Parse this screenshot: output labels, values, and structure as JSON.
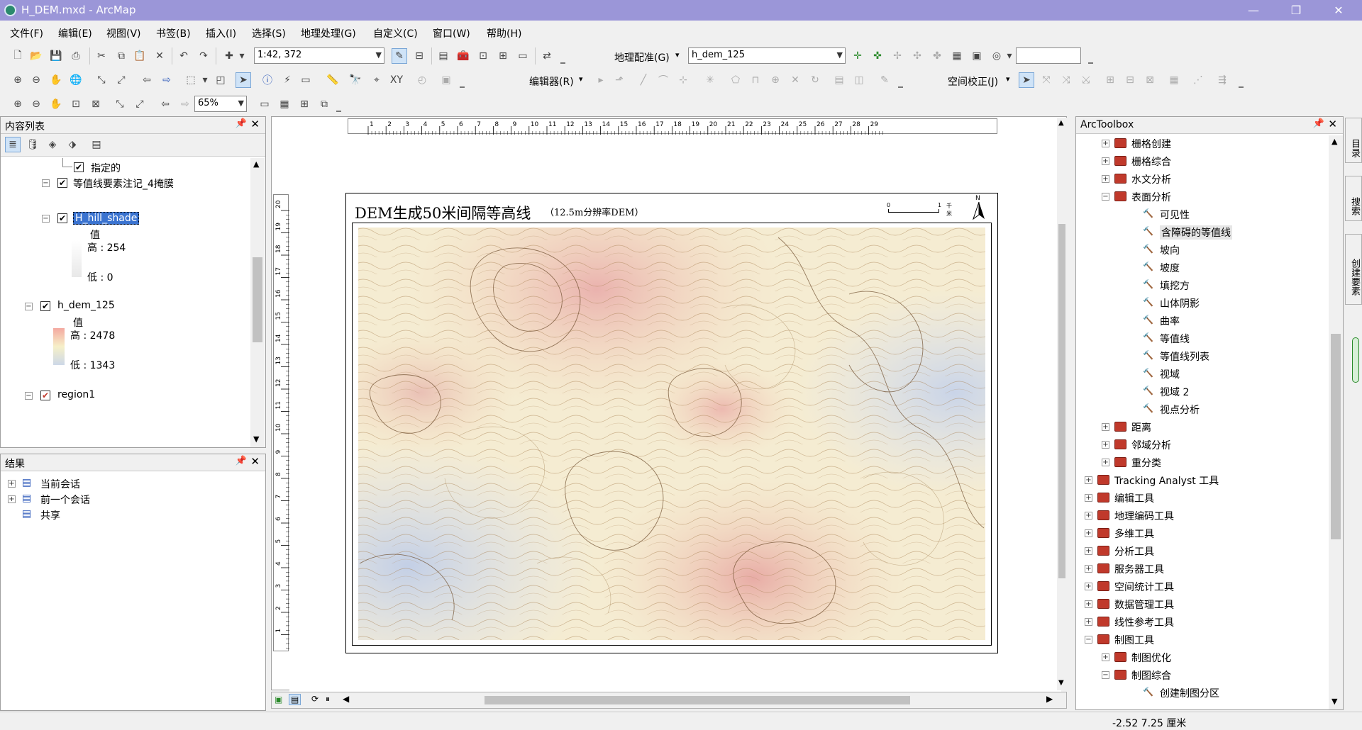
{
  "window": {
    "title": "H_DEM.mxd - ArcMap",
    "minimize": "—",
    "maximize": "❐",
    "close": "✕"
  },
  "menu": [
    "文件(F)",
    "编辑(E)",
    "视图(V)",
    "书签(B)",
    "插入(I)",
    "选择(S)",
    "地理处理(G)",
    "自定义(C)",
    "窗口(W)",
    "帮助(H)"
  ],
  "toolbar": {
    "scale_value": "1:42, 372",
    "georef_label": "地理配准(G)",
    "georef_layer": "h_dem_125",
    "editor_label": "编辑器(R)",
    "spatial_adjust_label": "空间校正(J)",
    "zoom_value": "65%"
  },
  "toc": {
    "title": "内容列表",
    "items": [
      {
        "label": "指定的"
      },
      {
        "label": "等值线要素注记_4掩膜"
      },
      {
        "label": "H_hill_shade"
      },
      {
        "label": "值"
      },
      {
        "label": "高 : 254"
      },
      {
        "label": "低 : 0"
      },
      {
        "label": "h_dem_125"
      },
      {
        "label": "值"
      },
      {
        "label": "高 : 2478"
      },
      {
        "label": "低 : 1343"
      },
      {
        "label": "region1"
      }
    ]
  },
  "results": {
    "title": "结果",
    "items": [
      {
        "label": "当前会话"
      },
      {
        "label": "前一个会话"
      },
      {
        "label": "共享"
      }
    ]
  },
  "map": {
    "title": "DEM生成50米间隔等高线",
    "subtitle": "（12.5m分辨率DEM）",
    "scalebar_zero": "0",
    "scalebar_one": "1",
    "scalebar_unit": "千米",
    "north": "N"
  },
  "ruler_h": [
    "1",
    "2",
    "3",
    "4",
    "5",
    "6",
    "7",
    "8",
    "9",
    "10",
    "11",
    "12",
    "13",
    "14",
    "15",
    "16",
    "17",
    "18",
    "19",
    "20",
    "21",
    "22",
    "23",
    "24",
    "25",
    "26",
    "27",
    "28",
    "29"
  ],
  "ruler_v": [
    "20",
    "19",
    "18",
    "17",
    "16",
    "15",
    "14",
    "13",
    "12",
    "11",
    "10",
    "9",
    "8",
    "7",
    "6",
    "5",
    "4",
    "3",
    "2",
    "1"
  ],
  "toolbox": {
    "title": "ArcToolbox",
    "items": [
      {
        "label": "栅格创建",
        "kind": "box",
        "indent": 1,
        "exp": "+"
      },
      {
        "label": "栅格综合",
        "kind": "box",
        "indent": 1,
        "exp": "+"
      },
      {
        "label": "水文分析",
        "kind": "box",
        "indent": 1,
        "exp": "+"
      },
      {
        "label": "表面分析",
        "kind": "box",
        "indent": 1,
        "exp": "−"
      },
      {
        "label": "可见性",
        "kind": "tool",
        "indent": 2
      },
      {
        "label": "含障碍的等值线",
        "kind": "tool",
        "indent": 2,
        "selected": true
      },
      {
        "label": "坡向",
        "kind": "tool",
        "indent": 2
      },
      {
        "label": "坡度",
        "kind": "tool",
        "indent": 2
      },
      {
        "label": "填挖方",
        "kind": "tool",
        "indent": 2
      },
      {
        "label": "山体阴影",
        "kind": "tool",
        "indent": 2
      },
      {
        "label": "曲率",
        "kind": "tool",
        "indent": 2
      },
      {
        "label": "等值线",
        "kind": "tool",
        "indent": 2
      },
      {
        "label": "等值线列表",
        "kind": "tool",
        "indent": 2
      },
      {
        "label": "视域",
        "kind": "tool",
        "indent": 2
      },
      {
        "label": "视域 2",
        "kind": "tool",
        "indent": 2
      },
      {
        "label": "视点分析",
        "kind": "tool",
        "indent": 2
      },
      {
        "label": "距离",
        "kind": "box",
        "indent": 1,
        "exp": "+"
      },
      {
        "label": "邻域分析",
        "kind": "box",
        "indent": 1,
        "exp": "+"
      },
      {
        "label": "重分类",
        "kind": "box",
        "indent": 1,
        "exp": "+"
      },
      {
        "label": "Tracking Analyst 工具",
        "kind": "box",
        "indent": 0,
        "exp": "+"
      },
      {
        "label": "编辑工具",
        "kind": "box",
        "indent": 0,
        "exp": "+"
      },
      {
        "label": "地理编码工具",
        "kind": "box",
        "indent": 0,
        "exp": "+"
      },
      {
        "label": "多维工具",
        "kind": "box",
        "indent": 0,
        "exp": "+"
      },
      {
        "label": "分析工具",
        "kind": "box",
        "indent": 0,
        "exp": "+"
      },
      {
        "label": "服务器工具",
        "kind": "box",
        "indent": 0,
        "exp": "+"
      },
      {
        "label": "空间统计工具",
        "kind": "box",
        "indent": 0,
        "exp": "+"
      },
      {
        "label": "数据管理工具",
        "kind": "box",
        "indent": 0,
        "exp": "+"
      },
      {
        "label": "线性参考工具",
        "kind": "box",
        "indent": 0,
        "exp": "+"
      },
      {
        "label": "制图工具",
        "kind": "box",
        "indent": 0,
        "exp": "−"
      },
      {
        "label": "制图优化",
        "kind": "box",
        "indent": 1,
        "exp": "+"
      },
      {
        "label": "制图综合",
        "kind": "box",
        "indent": 1,
        "exp": "−"
      },
      {
        "label": "创建制图分区",
        "kind": "tool",
        "indent": 2
      }
    ]
  },
  "side_tabs": [
    "目录",
    "搜索",
    "创建要素"
  ],
  "status": {
    "coords": "-2.52  7.25 厘米"
  },
  "colors": {
    "titlebar": "#9b96d8",
    "selection": "#3a73d0",
    "toolbox_red": "#c0392b"
  }
}
